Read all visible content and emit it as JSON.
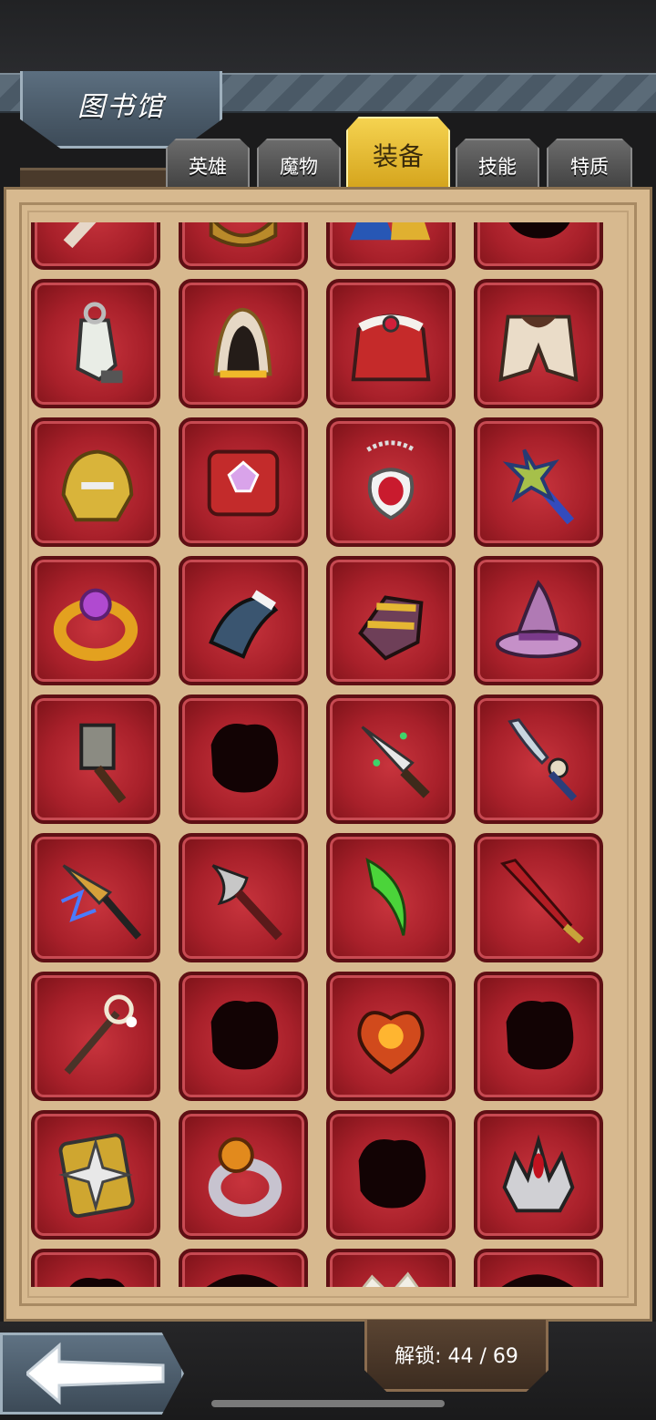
{
  "header": {
    "title": "图书馆"
  },
  "tabs": [
    {
      "label": "英雄",
      "active": false
    },
    {
      "label": "魔物",
      "active": false
    },
    {
      "label": "装备",
      "active": true
    },
    {
      "label": "技能",
      "active": false
    },
    {
      "label": "特质",
      "active": false
    }
  ],
  "footer": {
    "unlock_label": "解锁: 44 / 69"
  },
  "grid": {
    "slots": [
      {
        "icon": "partial-blade-icon"
      },
      {
        "icon": "partial-gauntlet-icon"
      },
      {
        "icon": "partial-boots-icon"
      },
      {
        "icon": "locked-silhouette-icon"
      },
      {
        "icon": "whistle-icon"
      },
      {
        "icon": "golden-hood-icon"
      },
      {
        "icon": "fur-cape-icon"
      },
      {
        "icon": "mantle-icon"
      },
      {
        "icon": "golden-helmet-icon"
      },
      {
        "icon": "red-tome-icon"
      },
      {
        "icon": "ruby-pendant-icon"
      },
      {
        "icon": "shuriken-staff-icon"
      },
      {
        "icon": "gem-ring-icon"
      },
      {
        "icon": "spectral-claw-icon"
      },
      {
        "icon": "golden-gauntlet-icon"
      },
      {
        "icon": "witch-hat-icon"
      },
      {
        "icon": "war-hammer-icon"
      },
      {
        "icon": "locked-silhouette-icon"
      },
      {
        "icon": "jade-dagger-icon"
      },
      {
        "icon": "bone-blade-icon"
      },
      {
        "icon": "lightning-spear-icon"
      },
      {
        "icon": "battle-axe-icon"
      },
      {
        "icon": "green-scythe-icon"
      },
      {
        "icon": "crimson-sword-icon"
      },
      {
        "icon": "bell-scepter-icon"
      },
      {
        "icon": "locked-silhouette-icon"
      },
      {
        "icon": "heart-relic-icon"
      },
      {
        "icon": "locked-silhouette-icon"
      },
      {
        "icon": "spiked-shield-icon"
      },
      {
        "icon": "pumpkin-ring-icon"
      },
      {
        "icon": "locked-silhouette-icon"
      },
      {
        "icon": "horned-crown-icon"
      },
      {
        "icon": "locked-silhouette-icon"
      },
      {
        "icon": "partial-item-icon"
      },
      {
        "icon": "partial-crown-icon"
      },
      {
        "icon": "partial-item-icon"
      }
    ]
  }
}
